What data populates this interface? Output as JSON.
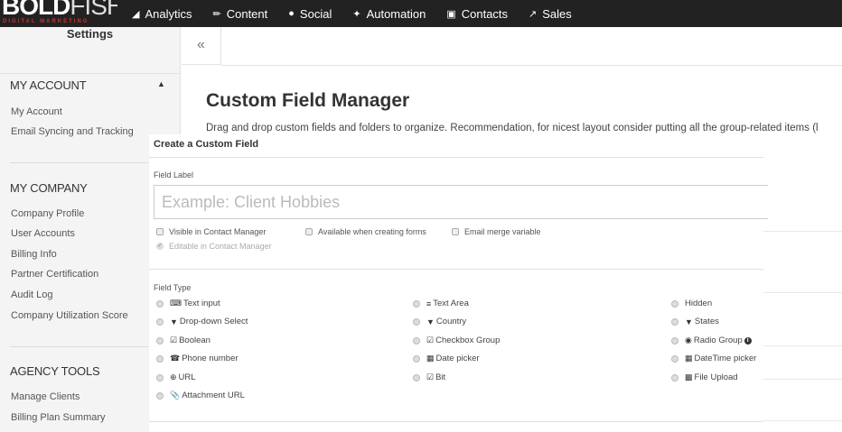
{
  "brand": {
    "name_bold": "BOLD",
    "name_thin": "FISH",
    "tagline": "DIGITAL MARKETING"
  },
  "nav": [
    {
      "label": "Analytics",
      "icon": "chart-icon"
    },
    {
      "label": "Content",
      "icon": "pencil-icon"
    },
    {
      "label": "Social",
      "icon": "chat-icon"
    },
    {
      "label": "Automation",
      "icon": "magic-wand-icon"
    },
    {
      "label": "Contacts",
      "icon": "contact-card-icon"
    },
    {
      "label": "Sales",
      "icon": "trend-icon"
    }
  ],
  "sidebar": {
    "title": "Settings",
    "sections": [
      {
        "heading": "MY ACCOUNT",
        "items": [
          "My Account",
          "Email Syncing and Tracking"
        ]
      },
      {
        "heading": "MY COMPANY",
        "items": [
          "Company Profile",
          "User Accounts",
          "Billing Info",
          "Partner Certification",
          "Audit Log",
          "Company Utilization Score"
        ]
      },
      {
        "heading": "AGENCY TOOLS",
        "items": [
          "Manage Clients",
          "Billing Plan Summary"
        ]
      }
    ]
  },
  "collapse_label": "«",
  "page": {
    "title": "Custom Field Manager",
    "description": "Drag and drop custom fields and folders to organize. Recommendation, for nicest layout consider putting all the group-related items (l"
  },
  "modal": {
    "title": "Create a Custom Field",
    "field_label": "Field Label",
    "placeholder": "Example: Client Hobbies",
    "options": {
      "visible": "Visible in Contact Manager",
      "available": "Available when creating forms",
      "merge": "Email merge variable",
      "editable": "Editable in Contact Manager"
    },
    "field_type_label": "Field Type",
    "field_types": [
      [
        {
          "label": "Text input",
          "icon": "text-input-icon"
        },
        {
          "label": "Text Area",
          "icon": "text-area-icon"
        },
        {
          "label": "Hidden",
          "icon": ""
        }
      ],
      [
        {
          "label": "Drop-down Select",
          "icon": "dropdown-icon"
        },
        {
          "label": "Country",
          "icon": "dropdown-icon"
        },
        {
          "label": "States",
          "icon": "dropdown-icon"
        }
      ],
      [
        {
          "label": "Boolean",
          "icon": "checkbox-icon"
        },
        {
          "label": "Checkbox Group",
          "icon": "checkbox-icon"
        },
        {
          "label": "Radio Group",
          "icon": "radio-icon"
        }
      ],
      [
        {
          "label": "Phone number",
          "icon": "phone-icon"
        },
        {
          "label": "Date picker",
          "icon": "calendar-icon"
        },
        {
          "label": "DateTime picker",
          "icon": "calendar-icon"
        }
      ],
      [
        {
          "label": "URL",
          "icon": "globe-icon"
        },
        {
          "label": "Bit",
          "icon": "checkbox-icon"
        },
        {
          "label": "File Upload",
          "icon": "file-icon"
        }
      ],
      [
        {
          "label": "Attachment URL",
          "icon": "paperclip-icon"
        }
      ]
    ]
  }
}
